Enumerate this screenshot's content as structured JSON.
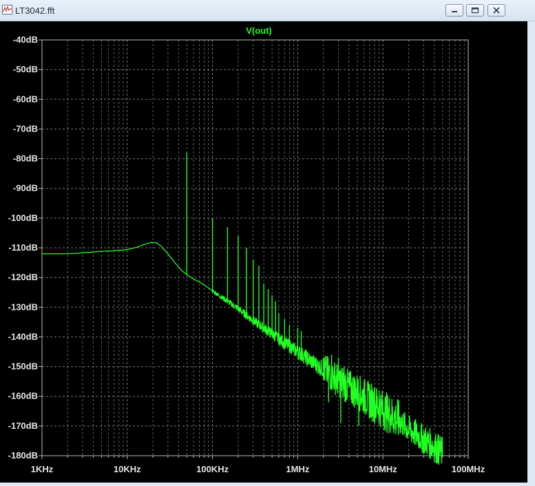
{
  "window": {
    "title": "LT3042.fft",
    "controls": {
      "minimize": "minimize",
      "maximize": "maximize",
      "close": "close"
    }
  },
  "colors": {
    "background": "#000000",
    "trace": "#22ff22",
    "grid": "#8c8c8c",
    "text": "#e6e6e6",
    "title": "#22ff22"
  },
  "chart_data": {
    "type": "line",
    "title": "V(out)",
    "xscale": "log",
    "xlim": [
      1000,
      100000000
    ],
    "ylim": [
      -180,
      -40
    ],
    "x_ticks": [
      {
        "value": 1000,
        "label": "1KHz"
      },
      {
        "value": 10000,
        "label": "10KHz"
      },
      {
        "value": 100000,
        "label": "100KHz"
      },
      {
        "value": 1000000,
        "label": "1MHz"
      },
      {
        "value": 10000000,
        "label": "10MHz"
      },
      {
        "value": 100000000,
        "label": "100MHz"
      }
    ],
    "y_ticks": [
      {
        "value": -40,
        "label": "-40dB"
      },
      {
        "value": -50,
        "label": "-50dB"
      },
      {
        "value": -60,
        "label": "-60dB"
      },
      {
        "value": -70,
        "label": "-70dB"
      },
      {
        "value": -80,
        "label": "-80dB"
      },
      {
        "value": -90,
        "label": "-90dB"
      },
      {
        "value": -100,
        "label": "-100dB"
      },
      {
        "value": -110,
        "label": "-110dB"
      },
      {
        "value": -120,
        "label": "-120dB"
      },
      {
        "value": -130,
        "label": "-130dB"
      },
      {
        "value": -140,
        "label": "-140dB"
      },
      {
        "value": -150,
        "label": "-150dB"
      },
      {
        "value": -160,
        "label": "-160dB"
      },
      {
        "value": -170,
        "label": "-170dB"
      },
      {
        "value": -180,
        "label": "-180dB"
      }
    ],
    "grid": true,
    "grid_style": "dashed",
    "series": [
      {
        "name": "V(out)",
        "baseline": [
          [
            1000,
            -112
          ],
          [
            2000,
            -112
          ],
          [
            3000,
            -111.7
          ],
          [
            5000,
            -111.2
          ],
          [
            7000,
            -111
          ],
          [
            10000,
            -110.6
          ],
          [
            13000,
            -109.8
          ],
          [
            16000,
            -108.8
          ],
          [
            19000,
            -108.2
          ],
          [
            22000,
            -108.3
          ],
          [
            25000,
            -109.5
          ],
          [
            30000,
            -112
          ],
          [
            35000,
            -114.5
          ],
          [
            40000,
            -116.5
          ],
          [
            45000,
            -118
          ],
          [
            50000,
            -119
          ],
          [
            60000,
            -120.5
          ],
          [
            70000,
            -121.5
          ],
          [
            80000,
            -122.5
          ],
          [
            90000,
            -123.5
          ],
          [
            100000,
            -124.5
          ],
          [
            150000,
            -128
          ],
          [
            200000,
            -130.5
          ],
          [
            300000,
            -134.5
          ],
          [
            400000,
            -137
          ],
          [
            500000,
            -139
          ],
          [
            700000,
            -142
          ],
          [
            1000000,
            -145
          ],
          [
            1500000,
            -148.5
          ],
          [
            2000000,
            -151
          ],
          [
            3000000,
            -154.5
          ],
          [
            4000000,
            -157
          ],
          [
            5000000,
            -158.5
          ],
          [
            7000000,
            -161.5
          ],
          [
            10000000,
            -164.5
          ],
          [
            15000000,
            -168
          ],
          [
            20000000,
            -171
          ],
          [
            30000000,
            -174.5
          ],
          [
            40000000,
            -177
          ],
          [
            50000000,
            -179
          ]
        ],
        "spikes": [
          [
            50000,
            -78
          ],
          [
            100000,
            -100
          ],
          [
            150000,
            -103
          ],
          [
            200000,
            -106
          ],
          [
            250000,
            -110
          ],
          [
            300000,
            -114
          ],
          [
            350000,
            -116
          ],
          [
            400000,
            -122
          ],
          [
            450000,
            -124
          ],
          [
            500000,
            -126
          ],
          [
            550000,
            -128
          ],
          [
            600000,
            -132
          ],
          [
            700000,
            -134
          ],
          [
            800000,
            -136
          ],
          [
            1000000,
            -137
          ],
          [
            1100000,
            -138
          ],
          [
            2000000,
            -147
          ],
          [
            2500000,
            -146
          ],
          [
            3000000,
            -147
          ],
          [
            3500000,
            -150
          ],
          [
            4000000,
            -152
          ],
          [
            6000000,
            -155
          ],
          [
            7000000,
            -156
          ],
          [
            8000000,
            -157
          ],
          [
            9000000,
            -158
          ]
        ],
        "dips": [
          [
            2300000,
            -162
          ],
          [
            3200000,
            -169
          ],
          [
            5200000,
            -170
          ]
        ]
      }
    ]
  }
}
